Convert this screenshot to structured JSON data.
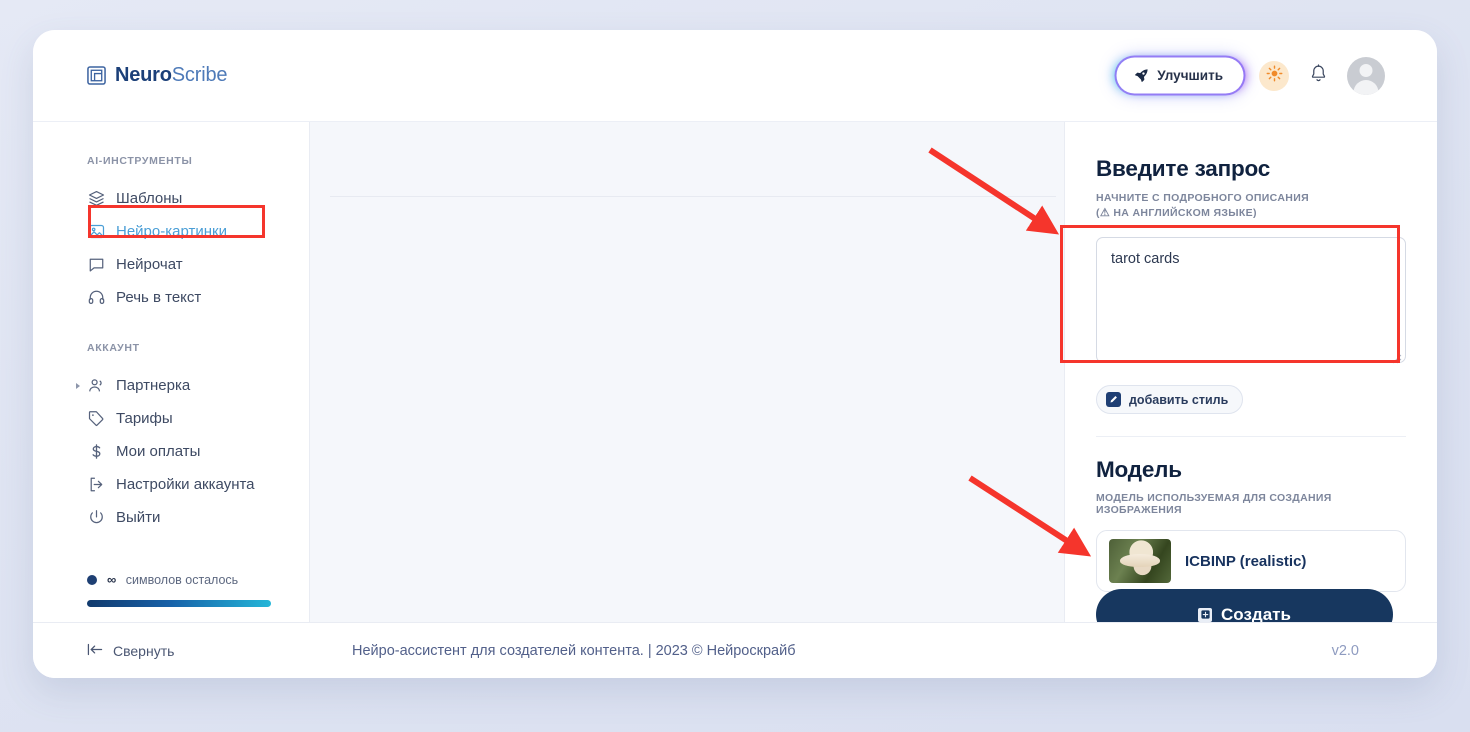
{
  "brand": {
    "name_bold": "Neuro",
    "name_light": "Scribe",
    "logo_icon": "nested-square-logo-icon"
  },
  "header": {
    "improve_label": "Улучшить",
    "improve_icon": "rocket-icon",
    "theme_icon": "sun-icon",
    "notifications_icon": "bell-icon",
    "avatar_icon": "user-avatar-icon"
  },
  "sidebar": {
    "section_tools_label": "AI-ИНСТРУМЕНТЫ",
    "tools": [
      {
        "label": "Шаблоны",
        "icon": "layers-icon",
        "active": false,
        "caret": false
      },
      {
        "label": "Нейро-картинки",
        "icon": "image-icon",
        "active": true,
        "caret": false
      },
      {
        "label": "Нейрочат",
        "icon": "chat-bubble-icon",
        "active": false,
        "caret": false
      },
      {
        "label": "Речь в текст",
        "icon": "headphones-icon",
        "active": false,
        "caret": false
      }
    ],
    "section_account_label": "АККАУНТ",
    "account": [
      {
        "label": "Партнерка",
        "icon": "users-icon",
        "active": false,
        "caret": true
      },
      {
        "label": "Тарифы",
        "icon": "tag-icon",
        "active": false,
        "caret": false
      },
      {
        "label": "Мои оплаты",
        "icon": "dollar-icon",
        "active": false,
        "caret": false
      },
      {
        "label": "Настройки аккаунта",
        "icon": "logout-arrow-icon",
        "active": false,
        "caret": false
      },
      {
        "label": "Выйти",
        "icon": "power-icon",
        "active": false,
        "caret": false
      }
    ],
    "quota": {
      "amount": "∞",
      "label": "символов осталось",
      "progress_percent": 100,
      "bar_gradient_from": "#123a6d",
      "bar_gradient_to": "#24b6d8"
    }
  },
  "right_panel": {
    "prompt_title": "Введите запрос",
    "prompt_subtitle_line1": "НАЧНИТЕ С ПОДРОБНОГО ОПИСАНИЯ",
    "prompt_subtitle_line2_pre": "(",
    "prompt_subtitle_warn_icon": "⚠",
    "prompt_subtitle_line2_post": " НА АНГЛИЙСКОМ ЯЗЫКЕ)",
    "prompt_value": "tarot cards",
    "prompt_placeholder": "",
    "style_button_label": "добавить стиль",
    "style_button_icon": "pencil-square-icon",
    "model_title": "Модель",
    "model_subtitle": "МОДЕЛЬ ИСПОЛЬЗУЕМАЯ ДЛЯ СОЗДАНИЯ ИЗОБРАЖЕНИЯ",
    "model_selected": "ICBINP (realistic)",
    "create_label": "Создать",
    "create_icon": "image-plus-icon",
    "create_bg": "#17375f"
  },
  "footer": {
    "collapse_label": "Свернуть",
    "collapse_icon": "collapse-left-icon",
    "credit": "Нейро-ассистент для создателей контента.  | 2023 © Нейроскрайб",
    "version": "v2.0"
  },
  "annotations": {
    "highlight_color": "#f5352c",
    "boxes": [
      "sidebar-neuro-images-item",
      "prompt-textarea"
    ],
    "arrows": [
      "arrow-to-prompt-textarea",
      "arrow-to-create-button"
    ]
  }
}
